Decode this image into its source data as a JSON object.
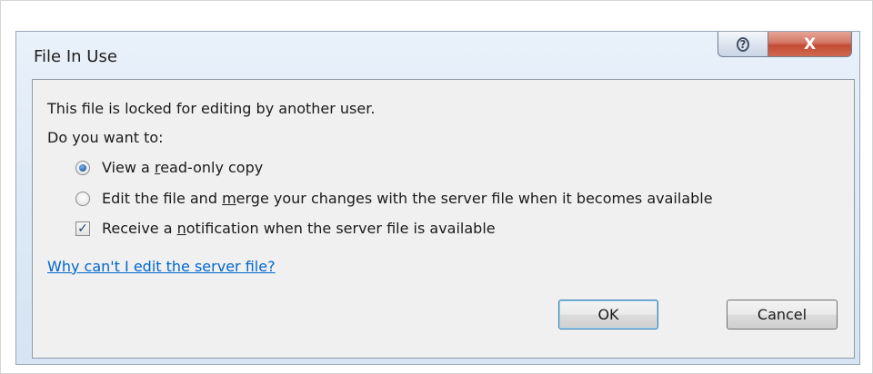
{
  "dialog": {
    "title": "File In Use",
    "help_glyph": "?",
    "close_glyph": "X",
    "message_line1": "This file is locked for editing by another user.",
    "message_line2": "Do you want to:",
    "options": [
      {
        "type": "radio",
        "checked": true,
        "label_pre": "View a ",
        "label_mnemonic": "r",
        "label_post": "ead-only copy"
      },
      {
        "type": "radio",
        "checked": false,
        "label_pre": "Edit the file and ",
        "label_mnemonic": "m",
        "label_post": "erge your changes with the server file when it becomes available"
      },
      {
        "type": "checkbox",
        "checked": true,
        "label_pre": "Receive a ",
        "label_mnemonic": "n",
        "label_post": "otification when the server file is available"
      }
    ],
    "help_link": "Why can't I edit the server file?",
    "ok_label": "OK",
    "cancel_label": "Cancel",
    "checkmark_glyph": "✓"
  },
  "icons": {
    "help": "help-icon",
    "close": "close-icon"
  },
  "colors": {
    "link": "#0066cc",
    "close_button": "#c44a33",
    "radio_selected": "#2f6fb6"
  }
}
